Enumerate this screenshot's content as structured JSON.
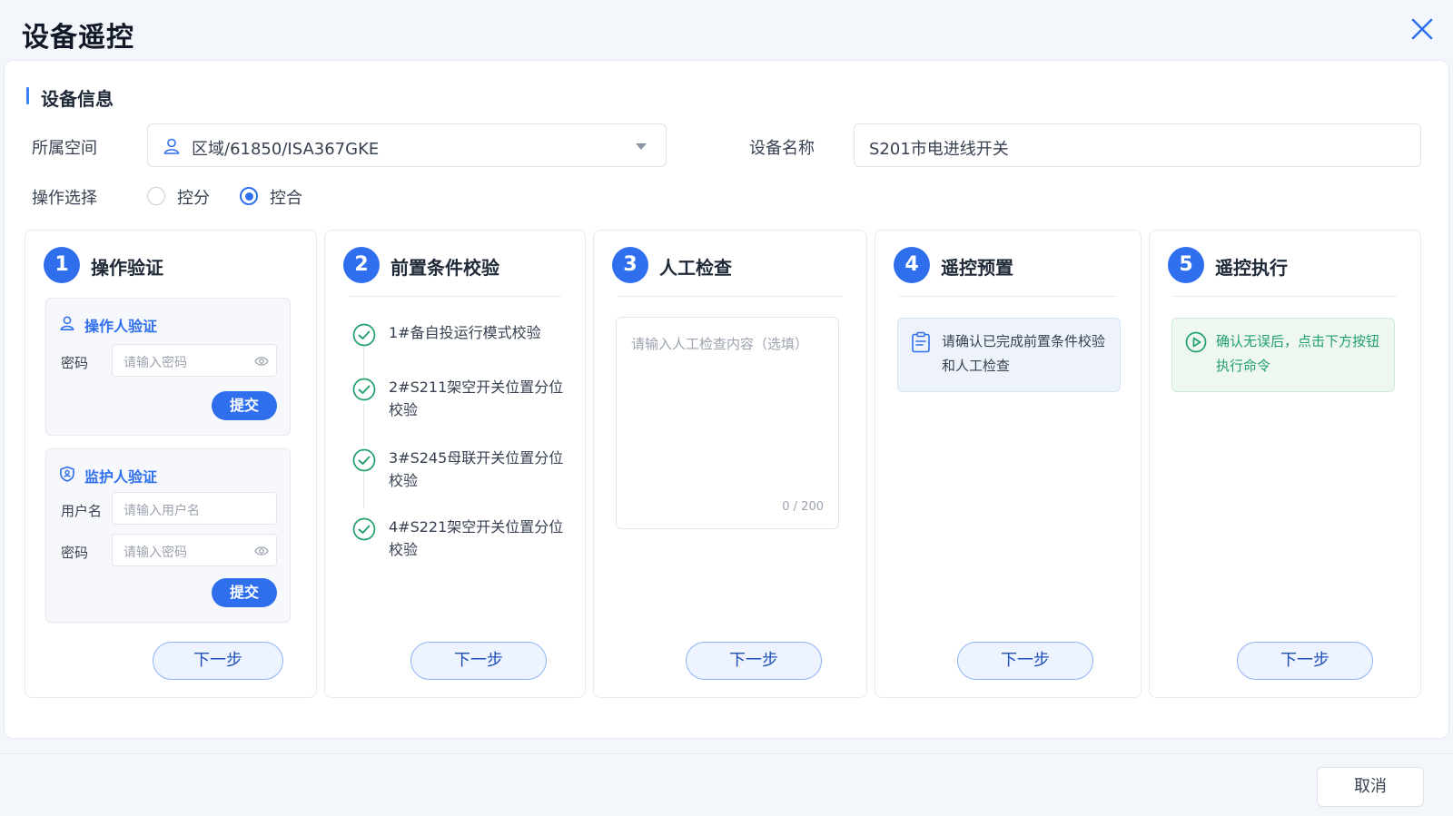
{
  "dialog": {
    "title": "设备遥控",
    "cancel_label": "取消"
  },
  "device_info": {
    "section_title": "设备信息",
    "space_label": "所属空间",
    "space_value": "区域/61850/ISA367GKE",
    "name_label": "设备名称",
    "name_value": "S201市电进线开关",
    "operation_label": "操作选择",
    "options": [
      {
        "label": "控分",
        "selected": false
      },
      {
        "label": "控合",
        "selected": true
      }
    ]
  },
  "next_label": "下一步",
  "steps": [
    {
      "num": "1",
      "title": "操作验证",
      "operator": {
        "title": "操作人验证",
        "password_label": "密码",
        "password_placeholder": "请输入密码",
        "submit": "提交"
      },
      "guardian": {
        "title": "监护人验证",
        "username_label": "用户名",
        "username_placeholder": "请输入用户名",
        "password_label": "密码",
        "password_placeholder": "请输入密码",
        "submit": "提交"
      }
    },
    {
      "num": "2",
      "title": "前置条件校验",
      "checks": [
        "1#备自投运行模式校验",
        "2#S211架空开关位置分位校验",
        "3#S245母联开关位置分位校验",
        "4#S221架空开关位置分位校验"
      ]
    },
    {
      "num": "3",
      "title": "人工检查",
      "placeholder": "请输入人工检查内容（选填）",
      "counter": "0 / 200"
    },
    {
      "num": "4",
      "title": "遥控预置",
      "notice": "请确认已完成前置条件校验和人工检查"
    },
    {
      "num": "5",
      "title": "遥控执行",
      "notice": "确认无误后，点击下方按钮执行命令"
    }
  ],
  "colors": {
    "primary": "#2f6fed",
    "success": "#22a06b",
    "info_bg": "#eef3fb",
    "success_bg": "#eef8f1"
  }
}
